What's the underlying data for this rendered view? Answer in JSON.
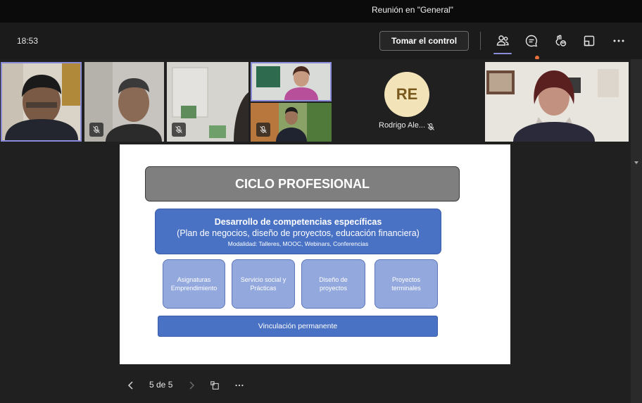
{
  "window": {
    "title": "Reunión en \"General\""
  },
  "toolbar": {
    "clock": "18:53",
    "take_control_label": "Tomar el control",
    "icons": [
      "people-icon",
      "chat-icon",
      "reactions-icon",
      "share-tray-icon",
      "more-icon"
    ]
  },
  "participants": [
    {
      "name": "",
      "muted": false,
      "active": true
    },
    {
      "name": "",
      "muted": true
    },
    {
      "name": "",
      "muted": true
    },
    {
      "name": "",
      "muted": false,
      "active": true
    },
    {
      "name": "",
      "muted": true
    },
    {
      "name": "Rodrigo Ale...",
      "initials": "RE",
      "muted": true
    },
    {
      "name": "",
      "muted": false
    }
  ],
  "slide": {
    "title": "CICLO PROFESIONAL",
    "main_box": {
      "line1": "Desarrollo de competencias específicas",
      "line2": "(Plan de negocios, diseño de proyectos, educación financiera)",
      "line3": "Modalidad: Talleres, MOOC, Webinars, Conferencias"
    },
    "sub_boxes": [
      {
        "line1": "Asignaturas",
        "line2": "Emprendimiento"
      },
      {
        "line1": "Servicio social y",
        "line2": "Prácticas"
      },
      {
        "line1": "Diseño de",
        "line2": "proyectos"
      },
      {
        "line1": "Proyectos",
        "line2": "terminales"
      }
    ],
    "bottom_bar": "Vinculación permanente"
  },
  "pager": {
    "label": "5 de 5"
  },
  "colors": {
    "accent": "#8b8cd9",
    "slide_blue": "#4a72c4",
    "slide_light_blue": "#93a8dc",
    "slide_gray": "#7f7f7f",
    "avatar_bg": "#f3e3b9"
  }
}
